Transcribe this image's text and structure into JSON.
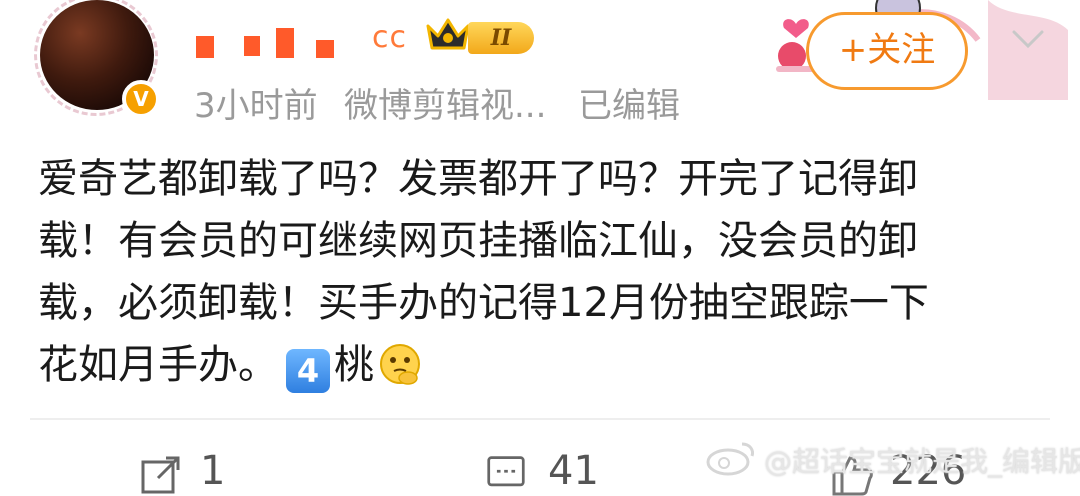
{
  "post": {
    "author": {
      "name_visible_part": "cc",
      "level_badge": "II",
      "verified": true
    },
    "meta": {
      "time": "3小时前",
      "source": "微博剪辑视...",
      "edited": "已编辑"
    },
    "follow_label": "+关注",
    "content_lines": [
      "爱奇艺都卸载了吗？发票都开了吗？开完了记得卸",
      "载！有会员的可继续网页挂播临江仙，没会员的卸",
      "载，必须卸载！买手办的记得12月份抽空跟踪一下",
      "花如月手办。"
    ],
    "number_badge": "4",
    "trailing_word": "桃",
    "actions": {
      "repost_count": "1",
      "comment_count": "41",
      "like_count": "226"
    },
    "watermark": "@超话宝宝就是我_编辑版"
  },
  "colors": {
    "follow": "#f07a12",
    "meta_text": "#9a9a9a",
    "name_highlight": "#ff5a2a"
  }
}
